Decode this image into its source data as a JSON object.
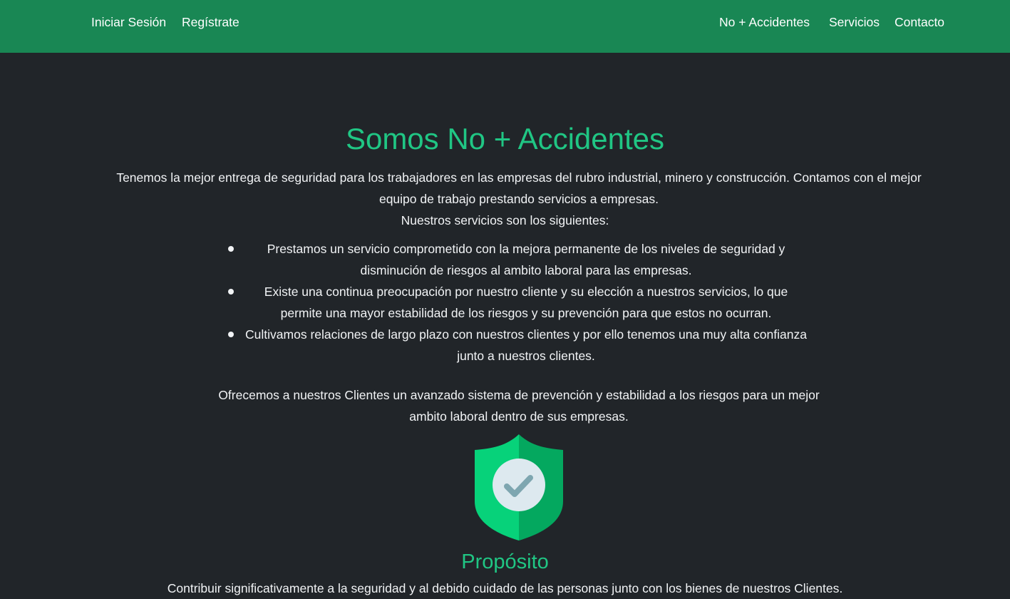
{
  "navbar": {
    "left_links": [
      "Iniciar Sesión",
      "Regístrate"
    ],
    "right_links": [
      "No + Accidentes",
      "Servicios",
      "Contacto"
    ]
  },
  "hero": {
    "title": "Somos No + Accidentes",
    "intro": "Tenemos la mejor entrega de seguridad para los trabajadores en las empresas del rubro industrial, minero y construcción. Contamos con el mejor equipo de trabajo prestando servicios a empresas.",
    "services_heading": "Nuestros servicios son los siguientes:",
    "services": [
      "Prestamos un servicio comprometido con la mejora permanente de los niveles de seguridad y disminución de riesgos al ambito laboral para las empresas.",
      "Existe una continua preocupación por nuestro cliente y su elección a nuestros servicios, lo que permite una mayor estabilidad de los riesgos y su prevención para que estos no ocurran.",
      "Cultivamos relaciones de largo plazo con nuestros clientes y por ello tenemos una muy alta confianza junto a nuestros clientes."
    ],
    "offer": "Ofrecemos a nuestros Clientes un avanzado sistema de prevención y estabilidad a los riesgos para un mejor ambito laboral dentro de sus empresas."
  },
  "purpose": {
    "icon": "shield-check-icon",
    "title": "Propósito",
    "text": "Contribuir significativamente a la seguridad y al debido cuidado de las personas junto con los bienes de nuestros Clientes."
  },
  "colors": {
    "navbar_bg": "#198754",
    "page_bg": "#212529",
    "accent": "#20c684",
    "shield_light": "#07d27a",
    "shield_dark": "#04a85f"
  }
}
